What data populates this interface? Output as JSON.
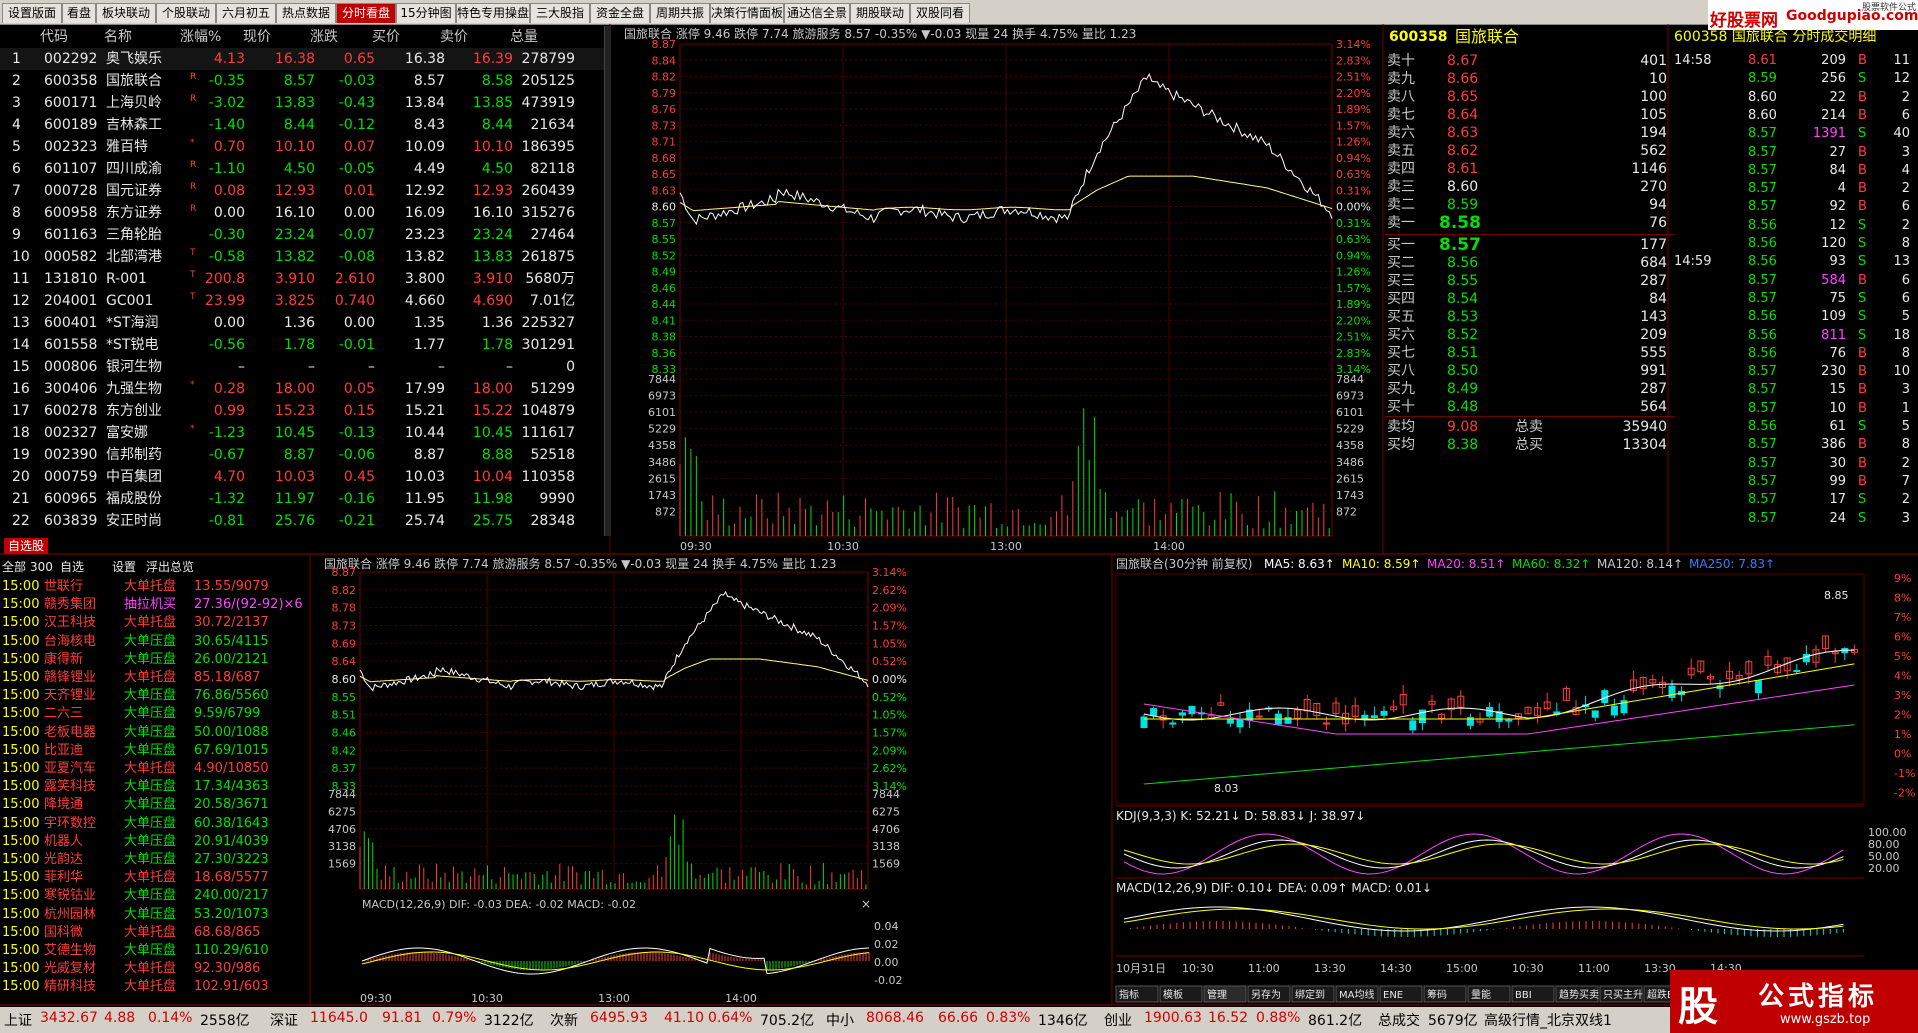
{
  "tabs": [
    "设置版面",
    "看盘",
    "板块联动",
    "个股联动",
    "六月初五",
    "热点数据",
    "分时看盘",
    "15分钟图",
    "特色专用操盘",
    "三大股指",
    "资金全盘",
    "周期共振",
    "决策行情面板",
    "通达信全景",
    "期股联动",
    "双股同看"
  ],
  "active_tab": "分时看盘",
  "watermark_top": {
    "brand": "好股票网",
    "url": "Goodgupiao.com",
    "maker": "股票软件公式"
  },
  "watchlist": {
    "headers": [
      "代码",
      "名称",
      "涨幅%",
      "现价",
      "涨跌",
      "买价",
      "卖价",
      "总量"
    ],
    "rows": [
      {
        "no": "1",
        "code": "002292",
        "name": "奥飞娱乐",
        "flag": "",
        "pct": "4.13",
        "price": "16.38",
        "chg": "0.65",
        "bid": "16.38",
        "ask": "16.39",
        "vol": "278799",
        "c": "r"
      },
      {
        "no": "2",
        "code": "600358",
        "name": "国旅联合",
        "flag": "R",
        "pct": "-0.35",
        "price": "8.57",
        "chg": "-0.03",
        "bid": "8.57",
        "ask": "8.58",
        "vol": "205125",
        "c": "g"
      },
      {
        "no": "3",
        "code": "600171",
        "name": "上海贝岭",
        "flag": "R",
        "pct": "-3.02",
        "price": "13.83",
        "chg": "-0.43",
        "bid": "13.84",
        "ask": "13.85",
        "vol": "473919",
        "c": "g"
      },
      {
        "no": "4",
        "code": "600189",
        "name": "吉林森工",
        "flag": "",
        "pct": "-1.40",
        "price": "8.44",
        "chg": "-0.12",
        "bid": "8.43",
        "ask": "8.44",
        "vol": "21634",
        "c": "g"
      },
      {
        "no": "5",
        "code": "002323",
        "name": "雅百特",
        "flag": "*",
        "pct": "0.70",
        "price": "10.10",
        "chg": "0.07",
        "bid": "10.09",
        "ask": "10.10",
        "vol": "186395",
        "c": "r"
      },
      {
        "no": "6",
        "code": "601107",
        "name": "四川成渝",
        "flag": "R",
        "pct": "-1.10",
        "price": "4.50",
        "chg": "-0.05",
        "bid": "4.49",
        "ask": "4.50",
        "vol": "82118",
        "c": "g"
      },
      {
        "no": "7",
        "code": "000728",
        "name": "国元证券",
        "flag": "R",
        "pct": "0.08",
        "price": "12.93",
        "chg": "0.01",
        "bid": "12.92",
        "ask": "12.93",
        "vol": "260439",
        "c": "r"
      },
      {
        "no": "8",
        "code": "600958",
        "name": "东方证券",
        "flag": "R",
        "pct": "0.00",
        "price": "16.10",
        "chg": "0.00",
        "bid": "16.09",
        "ask": "16.10",
        "vol": "315276",
        "c": "w"
      },
      {
        "no": "9",
        "code": "601163",
        "name": "三角轮胎",
        "flag": "",
        "pct": "-0.30",
        "price": "23.24",
        "chg": "-0.07",
        "bid": "23.23",
        "ask": "23.24",
        "vol": "27464",
        "c": "g"
      },
      {
        "no": "10",
        "code": "000582",
        "name": "北部湾港",
        "flag": "T",
        "pct": "-0.58",
        "price": "13.82",
        "chg": "-0.08",
        "bid": "13.82",
        "ask": "13.83",
        "vol": "261875",
        "c": "g"
      },
      {
        "no": "11",
        "code": "131810",
        "name": "R-001",
        "flag": "T",
        "pct": "200.8",
        "price": "3.910",
        "chg": "2.610",
        "bid": "3.800",
        "ask": "3.910",
        "vol": "5680万",
        "c": "r"
      },
      {
        "no": "12",
        "code": "204001",
        "name": "GC001",
        "flag": "T",
        "pct": "23.99",
        "price": "3.825",
        "chg": "0.740",
        "bid": "4.660",
        "ask": "4.690",
        "vol": "7.01亿",
        "c": "r"
      },
      {
        "no": "13",
        "code": "600401",
        "name": "*ST海润",
        "flag": "",
        "pct": "0.00",
        "price": "1.36",
        "chg": "0.00",
        "bid": "1.35",
        "ask": "1.36",
        "vol": "225327",
        "c": "w"
      },
      {
        "no": "14",
        "code": "601558",
        "name": "*ST锐电",
        "flag": "",
        "pct": "-0.56",
        "price": "1.78",
        "chg": "-0.01",
        "bid": "1.77",
        "ask": "1.78",
        "vol": "301291",
        "c": "g"
      },
      {
        "no": "15",
        "code": "000806",
        "name": "银河生物",
        "flag": "",
        "pct": "–",
        "price": "–",
        "chg": "–",
        "bid": "–",
        "ask": "–",
        "vol": "0",
        "c": "w"
      },
      {
        "no": "16",
        "code": "300406",
        "name": "九强生物",
        "flag": "*",
        "pct": "0.28",
        "price": "18.00",
        "chg": "0.05",
        "bid": "17.99",
        "ask": "18.00",
        "vol": "51299",
        "c": "r"
      },
      {
        "no": "17",
        "code": "600278",
        "name": "东方创业",
        "flag": "",
        "pct": "0.99",
        "price": "15.23",
        "chg": "0.15",
        "bid": "15.21",
        "ask": "15.22",
        "vol": "104879",
        "c": "r"
      },
      {
        "no": "18",
        "code": "002327",
        "name": "富安娜",
        "flag": "*",
        "pct": "-1.23",
        "price": "10.45",
        "chg": "-0.13",
        "bid": "10.44",
        "ask": "10.45",
        "vol": "111617",
        "c": "g"
      },
      {
        "no": "19",
        "code": "002390",
        "name": "信邦制药",
        "flag": "",
        "pct": "-0.67",
        "price": "8.87",
        "chg": "-0.06",
        "bid": "8.87",
        "ask": "8.88",
        "vol": "52518",
        "c": "g"
      },
      {
        "no": "20",
        "code": "000759",
        "name": "中百集团",
        "flag": "",
        "pct": "4.70",
        "price": "10.03",
        "chg": "0.45",
        "bid": "10.03",
        "ask": "10.04",
        "vol": "110358",
        "c": "r"
      },
      {
        "no": "21",
        "code": "600965",
        "name": "福成股份",
        "flag": "",
        "pct": "-1.32",
        "price": "11.97",
        "chg": "-0.16",
        "bid": "11.95",
        "ask": "11.98",
        "vol": "9990",
        "c": "g"
      },
      {
        "no": "22",
        "code": "603839",
        "name": "安正时尚",
        "flag": "",
        "pct": "-0.81",
        "price": "25.76",
        "chg": "-0.21",
        "bid": "25.74",
        "ask": "25.75",
        "vol": "28348",
        "c": "g"
      }
    ],
    "self_tab": "自选股"
  },
  "intraday_top": {
    "title": "国旅联合 涨停 9.46 跌停 7.74 旅游服务 8.57 -0.35% ▼-0.03 现量 24 换手 4.75% 量比 1.23",
    "price_labels": [
      "8.87",
      "8.84",
      "8.82",
      "8.79",
      "8.76",
      "8.73",
      "8.71",
      "8.68",
      "8.65",
      "8.63",
      "8.60",
      "8.57",
      "8.55",
      "8.52",
      "8.49",
      "8.46",
      "8.44",
      "8.41",
      "8.38",
      "8.36",
      "8.33"
    ],
    "pct_labels": [
      "3.14%",
      "2.83%",
      "2.51%",
      "2.20%",
      "1.89%",
      "1.57%",
      "1.26%",
      "0.94%",
      "0.63%",
      "0.31%",
      "0.00%",
      "0.31%",
      "0.63%",
      "0.94%",
      "1.26%",
      "1.57%",
      "1.89%",
      "2.20%",
      "2.51%",
      "2.83%",
      "3.14%"
    ],
    "vol_labels": [
      "7844",
      "6973",
      "6101",
      "5229",
      "4358",
      "3486",
      "2615",
      "1743",
      "872"
    ],
    "time_labels": [
      "09:30",
      "10:30",
      "13:00",
      "14:00"
    ]
  },
  "orderbook": {
    "code": "600358",
    "name": "国旅联合",
    "asks": [
      {
        "l": "卖十",
        "p": "8.67",
        "v": "401"
      },
      {
        "l": "卖九",
        "p": "8.66",
        "v": "10"
      },
      {
        "l": "卖八",
        "p": "8.65",
        "v": "100"
      },
      {
        "l": "卖七",
        "p": "8.64",
        "v": "105"
      },
      {
        "l": "卖六",
        "p": "8.63",
        "v": "194"
      },
      {
        "l": "卖五",
        "p": "8.62",
        "v": "562"
      },
      {
        "l": "卖四",
        "p": "8.61",
        "v": "1146"
      },
      {
        "l": "卖三",
        "p": "8.60",
        "v": "270"
      },
      {
        "l": "卖二",
        "p": "8.59",
        "v": "94"
      },
      {
        "l": "卖一",
        "p": "8.58",
        "v": "76"
      }
    ],
    "bids": [
      {
        "l": "买一",
        "p": "8.57",
        "v": "177"
      },
      {
        "l": "买二",
        "p": "8.56",
        "v": "684"
      },
      {
        "l": "买三",
        "p": "8.55",
        "v": "287"
      },
      {
        "l": "买四",
        "p": "8.54",
        "v": "84"
      },
      {
        "l": "买五",
        "p": "8.53",
        "v": "143"
      },
      {
        "l": "买六",
        "p": "8.52",
        "v": "209"
      },
      {
        "l": "买七",
        "p": "8.51",
        "v": "555"
      },
      {
        "l": "买八",
        "p": "8.50",
        "v": "991"
      },
      {
        "l": "买九",
        "p": "8.49",
        "v": "287"
      },
      {
        "l": "买十",
        "p": "8.48",
        "v": "564"
      }
    ],
    "avg_sell_label": "卖均",
    "avg_sell": "9.08",
    "total_sell_label": "总卖",
    "total_sell": "35940",
    "avg_buy_label": "买均",
    "avg_buy": "8.38",
    "total_buy_label": "总买",
    "total_buy": "13304"
  },
  "ticks": {
    "header": "600358 国旅联合 分时成交明细",
    "rows": [
      {
        "t": "14:58",
        "p": "8.61",
        "v": "209",
        "d": "B",
        "n": "11"
      },
      {
        "t": "",
        "p": "8.59",
        "v": "256",
        "d": "S",
        "n": "12"
      },
      {
        "t": "",
        "p": "8.60",
        "v": "22",
        "d": "B",
        "n": "2"
      },
      {
        "t": "",
        "p": "8.60",
        "v": "214",
        "d": "B",
        "n": "6"
      },
      {
        "t": "",
        "p": "8.57",
        "v": "1391",
        "d": "S",
        "n": "40"
      },
      {
        "t": "",
        "p": "8.57",
        "v": "27",
        "d": "B",
        "n": "3"
      },
      {
        "t": "",
        "p": "8.57",
        "v": "84",
        "d": "B",
        "n": "4"
      },
      {
        "t": "",
        "p": "8.57",
        "v": "4",
        "d": "B",
        "n": "2"
      },
      {
        "t": "",
        "p": "8.57",
        "v": "92",
        "d": "B",
        "n": "6"
      },
      {
        "t": "",
        "p": "8.56",
        "v": "12",
        "d": "S",
        "n": "2"
      },
      {
        "t": "",
        "p": "8.56",
        "v": "120",
        "d": "S",
        "n": "8"
      },
      {
        "t": "14:59",
        "p": "8.56",
        "v": "93",
        "d": "S",
        "n": "13"
      },
      {
        "t": "",
        "p": "8.57",
        "v": "584",
        "d": "B",
        "n": "6"
      },
      {
        "t": "",
        "p": "8.57",
        "v": "75",
        "d": "S",
        "n": "6"
      },
      {
        "t": "",
        "p": "8.56",
        "v": "109",
        "d": "S",
        "n": "5"
      },
      {
        "t": "",
        "p": "8.56",
        "v": "811",
        "d": "S",
        "n": "18"
      },
      {
        "t": "",
        "p": "8.56",
        "v": "76",
        "d": "B",
        "n": "8"
      },
      {
        "t": "",
        "p": "8.57",
        "v": "230",
        "d": "B",
        "n": "10"
      },
      {
        "t": "",
        "p": "8.57",
        "v": "15",
        "d": "B",
        "n": "3"
      },
      {
        "t": "",
        "p": "8.57",
        "v": "10",
        "d": "B",
        "n": "1"
      },
      {
        "t": "",
        "p": "8.56",
        "v": "61",
        "d": "S",
        "n": "5"
      },
      {
        "t": "",
        "p": "8.57",
        "v": "386",
        "d": "B",
        "n": "8"
      },
      {
        "t": "",
        "p": "8.57",
        "v": "30",
        "d": "B",
        "n": "2"
      },
      {
        "t": "",
        "p": "8.57",
        "v": "99",
        "d": "B",
        "n": "7"
      },
      {
        "t": "",
        "p": "8.57",
        "v": "17",
        "d": "S",
        "n": "2"
      },
      {
        "t": "",
        "p": "8.57",
        "v": "24",
        "d": "S",
        "n": "3"
      }
    ]
  },
  "alerts": {
    "header": [
      "全部",
      "300",
      "自选",
      "设置",
      "浮出",
      "总览"
    ],
    "rows": [
      {
        "t": "15:00",
        "n": "世联行",
        "a": "大单托盘",
        "v": "13.55/9079",
        "ac": "r"
      },
      {
        "t": "15:00",
        "n": "赣秀集团",
        "a": "抽拉机买",
        "v": "27.36/(92-92)×6",
        "ac": "m"
      },
      {
        "t": "15:00",
        "n": "汉王科技",
        "a": "大单托盘",
        "v": "30.72/2137",
        "ac": "r"
      },
      {
        "t": "15:00",
        "n": "台海核电",
        "a": "大单压盘",
        "v": "30.65/4115",
        "ac": "g"
      },
      {
        "t": "15:00",
        "n": "康得新",
        "a": "大单压盘",
        "v": "26.00/2121",
        "ac": "g"
      },
      {
        "t": "15:00",
        "n": "赣锋锂业",
        "a": "大单托盘",
        "v": "85.18/687",
        "ac": "r"
      },
      {
        "t": "15:00",
        "n": "天齐锂业",
        "a": "大单压盘",
        "v": "76.86/5560",
        "ac": "g"
      },
      {
        "t": "15:00",
        "n": "二六三",
        "a": "大单压盘",
        "v": "9.59/6799",
        "ac": "g"
      },
      {
        "t": "15:00",
        "n": "老板电器",
        "a": "大单压盘",
        "v": "50.00/1088",
        "ac": "g"
      },
      {
        "t": "15:00",
        "n": "比亚迪",
        "a": "大单压盘",
        "v": "67.69/1015",
        "ac": "g"
      },
      {
        "t": "15:00",
        "n": "亚夏汽车",
        "a": "大单托盘",
        "v": "4.90/10850",
        "ac": "r"
      },
      {
        "t": "15:00",
        "n": "露笑科技",
        "a": "大单压盘",
        "v": "17.34/4363",
        "ac": "g"
      },
      {
        "t": "15:00",
        "n": "降境通",
        "a": "大单压盘",
        "v": "20.58/3671",
        "ac": "g"
      },
      {
        "t": "15:00",
        "n": "宇环数控",
        "a": "大单压盘",
        "v": "60.38/1643",
        "ac": "g"
      },
      {
        "t": "15:00",
        "n": "机器人",
        "a": "大单压盘",
        "v": "20.91/4039",
        "ac": "g"
      },
      {
        "t": "15:00",
        "n": "光韵达",
        "a": "大单压盘",
        "v": "27.30/3223",
        "ac": "g"
      },
      {
        "t": "15:00",
        "n": "菲利华",
        "a": "大单托盘",
        "v": "18.68/5577",
        "ac": "r"
      },
      {
        "t": "15:00",
        "n": "寒锐钴业",
        "a": "大单压盘",
        "v": "240.00/217",
        "ac": "g"
      },
      {
        "t": "15:00",
        "n": "杭州园林",
        "a": "大单压盘",
        "v": "53.20/1073",
        "ac": "g"
      },
      {
        "t": "15:00",
        "n": "国科微",
        "a": "大单托盘",
        "v": "68.68/865",
        "ac": "r"
      },
      {
        "t": "15:00",
        "n": "艾德生物",
        "a": "大单压盘",
        "v": "110.29/610",
        "ac": "g"
      },
      {
        "t": "15:00",
        "n": "光威复材",
        "a": "大单托盘",
        "v": "92.30/986",
        "ac": "r"
      },
      {
        "t": "15:00",
        "n": "精研科技",
        "a": "大单托盘",
        "v": "102.91/603",
        "ac": "r"
      }
    ]
  },
  "intraday_bottom": {
    "title": "国旅联合 涨停 9.46 跌停 7.74 旅游服务 8.57 -0.35% ▼-0.03 现量 24 换手 4.75% 量比 1.23",
    "price_labels": [
      "8.87",
      "8.82",
      "8.78",
      "8.73",
      "8.69",
      "8.64",
      "8.60",
      "8.55",
      "8.51",
      "8.46",
      "8.42",
      "8.37",
      "8.33"
    ],
    "pct_labels": [
      "3.14%",
      "2.62%",
      "2.09%",
      "1.57%",
      "1.05%",
      "0.52%",
      "0.00%",
      "0.52%",
      "1.05%",
      "1.57%",
      "2.09%",
      "2.62%",
      "3.14%"
    ],
    "vol_labels": [
      "7844",
      "6275",
      "4706",
      "3138",
      "1569"
    ],
    "macd_title": "MACD(12,26,9) DIF: -0.03 DEA: -0.02 MACD: -0.02",
    "macd_labels": [
      "0.04",
      "0.02",
      "0.00",
      "-0.02"
    ],
    "time_labels": [
      "09:30",
      "10:30",
      "13:00",
      "14:00"
    ]
  },
  "kline": {
    "title_name": "国旅联合(30分钟 前复权)",
    "ma": [
      {
        "t": "MA5: 8.63↑",
        "c": "#ffffff"
      },
      {
        "t": "MA10: 8.59↑",
        "c": "#ffff00"
      },
      {
        "t": "MA20: 8.51↑",
        "c": "#ff44ff"
      },
      {
        "t": "MA60: 8.32↑",
        "c": "#00e000"
      },
      {
        "t": "MA120: 8.14↑",
        "c": "#c8c8c8"
      },
      {
        "t": "MA250: 7.83↑",
        "c": "#3a7bff"
      }
    ],
    "pct_labels": [
      "9%",
      "8%",
      "7%",
      "6%",
      "5%",
      "4%",
      "3%",
      "2%",
      "1%",
      "0%",
      "-1%",
      "-2%"
    ],
    "hi_label": "8.85",
    "lo_label": "8.03",
    "kdj_title": "KDJ(9,3,3) K: 52.21↓ D: 58.83↓ J: 38.97↓",
    "kdj_labels": [
      "100.00",
      "80.00",
      "50.00",
      "20.00"
    ],
    "macd_title": "MACD(12,26,9) DIF: 0.10↓ DEA: 0.09↑ MACD: 0.01↓",
    "time_labels": [
      "10月31日",
      "10:30",
      "11:00",
      "13:30",
      "14:30",
      "15:00",
      "10:30",
      "11:00",
      "13:30",
      "14:30"
    ],
    "bottom_tabs": [
      "指标",
      "模板",
      "管理",
      "另存为",
      "绑定到",
      "MA均线",
      "ENE",
      "筹码",
      "量能",
      "BBI",
      "趋势买卖",
      "只买主升浪",
      "超跌BOLL",
      "超级波段指"
    ]
  },
  "statusbar": [
    {
      "t": "上证",
      "c": "#000"
    },
    {
      "t": "3432.67",
      "c": "#d00000"
    },
    {
      "t": "4.88",
      "c": "#d00000"
    },
    {
      "t": "0.14%",
      "c": "#d00000"
    },
    {
      "t": "2558亿",
      "c": "#000"
    },
    {
      "t": "深证",
      "c": "#000"
    },
    {
      "t": "11645.0",
      "c": "#d00000"
    },
    {
      "t": "91.81",
      "c": "#d00000"
    },
    {
      "t": "0.79%",
      "c": "#d00000"
    },
    {
      "t": "3122亿",
      "c": "#000"
    },
    {
      "t": "次新",
      "c": "#000"
    },
    {
      "t": "6495.93",
      "c": "#d00000"
    },
    {
      "t": "41.10",
      "c": "#d00000"
    },
    {
      "t": "0.64%",
      "c": "#d00000"
    },
    {
      "t": "705.2亿",
      "c": "#000"
    },
    {
      "t": "中小",
      "c": "#000"
    },
    {
      "t": "8068.46",
      "c": "#d00000"
    },
    {
      "t": "66.66",
      "c": "#d00000"
    },
    {
      "t": "0.83%",
      "c": "#d00000"
    },
    {
      "t": "1346亿",
      "c": "#000"
    },
    {
      "t": "创业",
      "c": "#000"
    },
    {
      "t": "1900.63",
      "c": "#d00000"
    },
    {
      "t": "16.52",
      "c": "#d00000"
    },
    {
      "t": "0.88%",
      "c": "#d00000"
    },
    {
      "t": "861.2亿",
      "c": "#000"
    },
    {
      "t": "总成交",
      "c": "#000"
    },
    {
      "t": "5679亿",
      "c": "#000"
    },
    {
      "t": "高级行情_北京双线1",
      "c": "#000"
    }
  ],
  "watermark_bottom": {
    "left": "股",
    "right": "公式指标",
    "url": "www.gszb.top"
  }
}
